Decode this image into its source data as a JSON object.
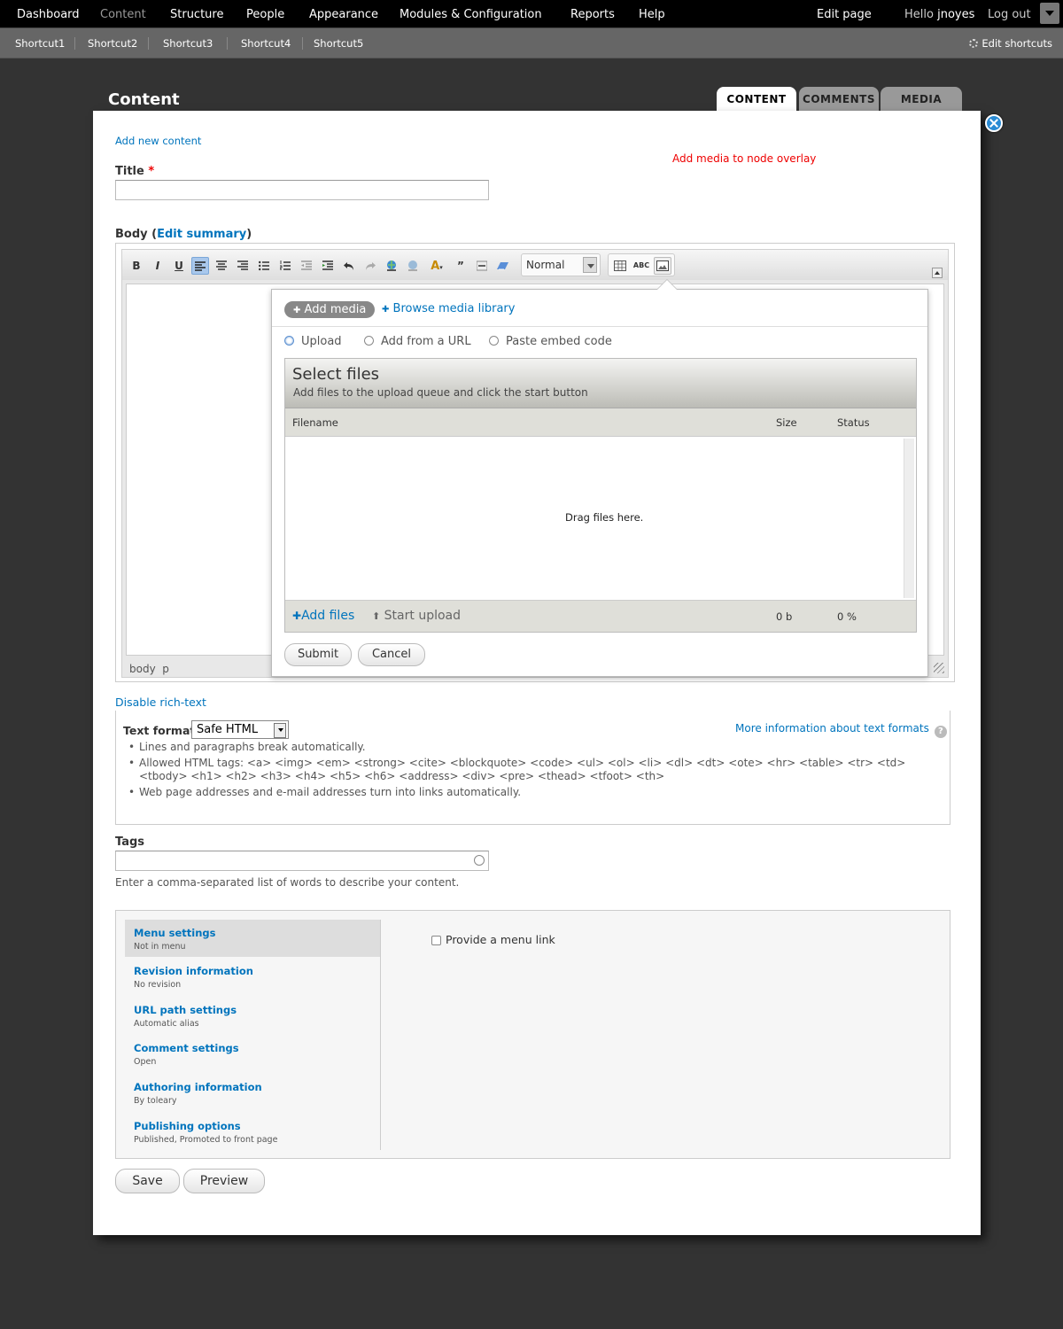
{
  "toolbar": {
    "items": [
      "Dashboard",
      "Content",
      "Structure",
      "People",
      "Appearance",
      "Modules & Configuration",
      "Reports",
      "Help"
    ],
    "edit_page": "Edit page",
    "hello": "Hello",
    "username": "jnoyes",
    "logout": "Log out"
  },
  "shortcuts": {
    "items": [
      "Shortcut1",
      "Shortcut2",
      "Shortcut3",
      "Shortcut4",
      "Shortcut5"
    ],
    "edit": "Edit shortcuts"
  },
  "overlay": {
    "title": "Content",
    "tabs": [
      "CONTENT",
      "COMMENTS",
      "MEDIA"
    ],
    "breadcrumb": "Add new content",
    "note": "Add media to node overlay"
  },
  "form": {
    "title_label": "Title",
    "title_required": "*",
    "body_label": "Body",
    "body_paren_open": "(",
    "edit_summary": "Edit summary",
    "body_paren_close": ")",
    "format_select": "Normal",
    "status_path": "body  p",
    "disable_rich": "Disable rich-text"
  },
  "media": {
    "add_media": "Add media",
    "browse": "Browse media library",
    "radios": [
      "Upload",
      "Add from a URL",
      "Paste embed code"
    ],
    "select_title": "Select files",
    "select_sub": "Add files to the upload queue and click the start button",
    "col_filename": "Filename",
    "col_size": "Size",
    "col_status": "Status",
    "drag": "Drag files here.",
    "add_files": "Add files",
    "start_upload": "Start upload",
    "total_size": "0 b",
    "total_pct": "0 %",
    "submit": "Submit",
    "cancel": "Cancel"
  },
  "text_format": {
    "label": "Text format",
    "value": "Safe HTML",
    "more_info": "More information about text formats",
    "tips": [
      "Lines and paragraphs break automatically.",
      "Allowed HTML tags: <a> <img> <em> <strong> <cite> <blockquote> <code> <ul> <ol> <li> <dl> <dt> <ote> <hr> <table> <tr> <td> <tbody> <h1> <h2> <h3> <h4> <h5> <h6> <address> <div> <pre> <thead> <tfoot> <th>",
      "Web page addresses and e-mail addresses turn into links automatically."
    ]
  },
  "tags": {
    "label": "Tags",
    "description": "Enter a comma-separated list of words to describe your content."
  },
  "vertical_tabs": [
    {
      "title": "Menu settings",
      "summary": "Not in menu"
    },
    {
      "title": "Revision information",
      "summary": "No revision"
    },
    {
      "title": "URL path settings",
      "summary": "Automatic alias"
    },
    {
      "title": "Comment settings",
      "summary": "Open"
    },
    {
      "title": "Authoring information",
      "summary": "By toleary"
    },
    {
      "title": "Publishing options",
      "summary": "Published, Promoted to front page"
    }
  ],
  "menu_pane": {
    "checkbox_label": "Provide a menu link"
  },
  "actions": {
    "save": "Save",
    "preview": "Preview"
  },
  "icons": {
    "bold": "B",
    "italic": "I",
    "underline": "U",
    "quote": "”",
    "plus": "✚",
    "up_arrow": "⬆",
    "help": "?"
  }
}
